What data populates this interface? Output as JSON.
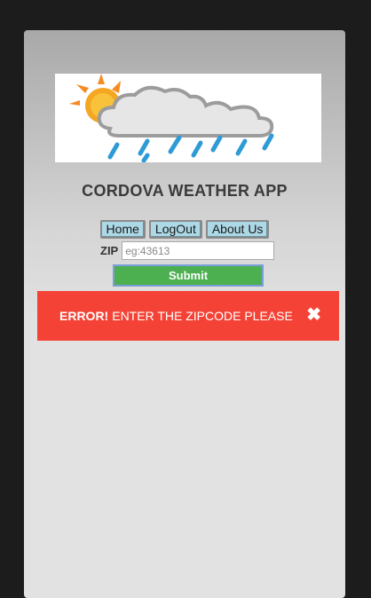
{
  "app": {
    "title": "CORDOVA WEATHER APP"
  },
  "logo": {
    "icon": "weather-rain-sun-icon"
  },
  "nav": {
    "items": [
      {
        "label": "Home"
      },
      {
        "label": "LogOut"
      },
      {
        "label": "About Us"
      }
    ]
  },
  "form": {
    "zip_label": "ZIP",
    "zip_value": "",
    "zip_placeholder": "eg:43613",
    "submit_label": "Submit"
  },
  "alert": {
    "strong": "ERROR!",
    "message": "ENTER THE ZIPCODE PLEASE",
    "close_symbol": "✖",
    "color": "#f44336"
  },
  "colors": {
    "nav_button": "#add8e6",
    "submit_button": "#4caf50"
  }
}
